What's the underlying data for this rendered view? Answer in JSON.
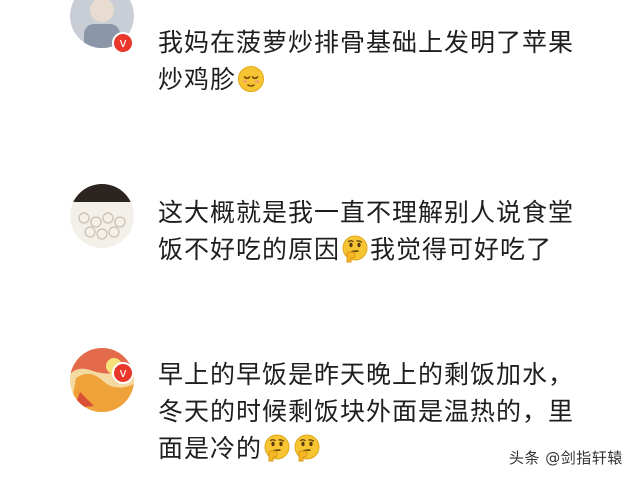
{
  "comments": [
    {
      "avatar": "user-avatar-gray",
      "badge": "v",
      "text_1": "我妈在菠萝炒排骨基础上发明了苹果炒鸡胗",
      "emoji_1": "relieved-face-emoji"
    },
    {
      "avatar": "user-avatar-lace",
      "badge": "",
      "text_1": "这大概就是我一直不理解别人说食堂饭不好吃的原因",
      "emoji_1": "thinking-face-emoji",
      "text_2": "我觉得可好吃了"
    },
    {
      "avatar": "user-avatar-colorful",
      "badge": "v",
      "text_1": "早上的早饭是昨天晚上的剩饭加水，冬天的时候剩饭块外面是温热的，里面是冷的",
      "emoji_1": "thinking-face-emoji",
      "emoji_2": "thinking-face-emoji"
    }
  ],
  "watermark": "头条 @剑指轩辕",
  "colors": {
    "badge": "#e9372c",
    "text": "#1e1e1e",
    "emoji_face": "#f7c531"
  }
}
